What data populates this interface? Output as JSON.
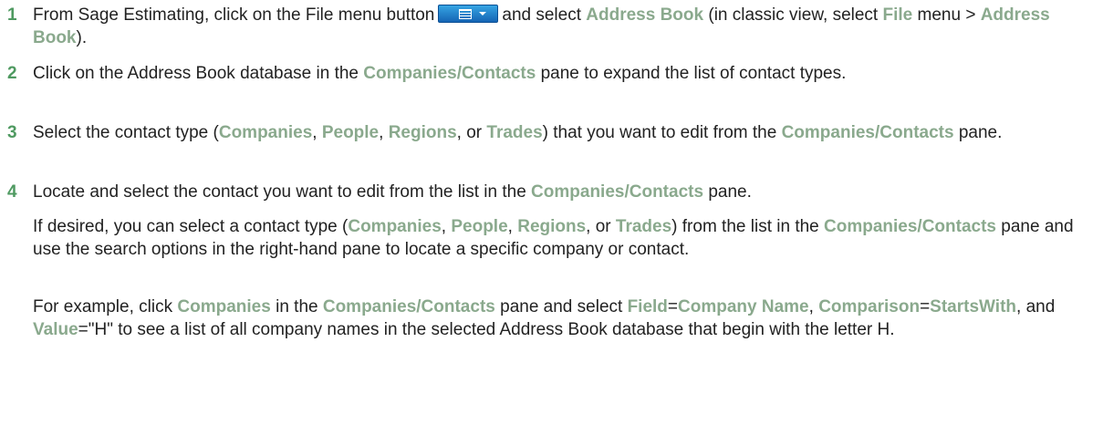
{
  "steps": [
    {
      "number": "1",
      "a": "From Sage Estimating, click on the File menu button",
      "b": "and select",
      "c": "Address Book",
      "d": "(in classic view, select",
      "e": "File",
      "f": "menu >",
      "g": "Address Book",
      "h": ")."
    },
    {
      "number": "2",
      "a": "Click on the Address Book database in the",
      "b": "Companies/Contacts",
      "c": "pane to expand the list of contact types."
    },
    {
      "number": "3",
      "a": "Select the contact type (",
      "b": "Companies",
      "c": ",",
      "d": "People",
      "e": ",",
      "f": "Regions",
      "g": ", or",
      "h": "Trades",
      "i": ") that you want to edit from the",
      "j": "Companies/Contacts",
      "k": "pane."
    },
    {
      "number": "4",
      "a": "Locate and select the contact you want to edit from the list in the",
      "b": "Companies/Contacts",
      "c": "pane.",
      "p1": {
        "a": "If desired, you can select a contact type (",
        "b": "Companies",
        "c": ",",
        "d": "People",
        "e": ",",
        "f": "Regions",
        "g": ", or",
        "h": "Trades",
        "i": ") from the list in the",
        "j": "Companies/Contacts",
        "k": "pane and use the search options in the right-hand pane to locate a specific company or contact."
      },
      "p2": {
        "a": "For example, click",
        "b": "Companies",
        "c": "in the",
        "d": "Companies/Contacts",
        "e": "pane and select",
        "f": "Field",
        "g": "=",
        "h": "Company Name",
        "i": ",",
        "j": "Comparison",
        "k": "=",
        "l": "StartsWith",
        "m": ", and",
        "n": "Value",
        "o": "=\"H\" to see a list of all company names in the selected Address Book database that begin with the letter H."
      }
    }
  ]
}
